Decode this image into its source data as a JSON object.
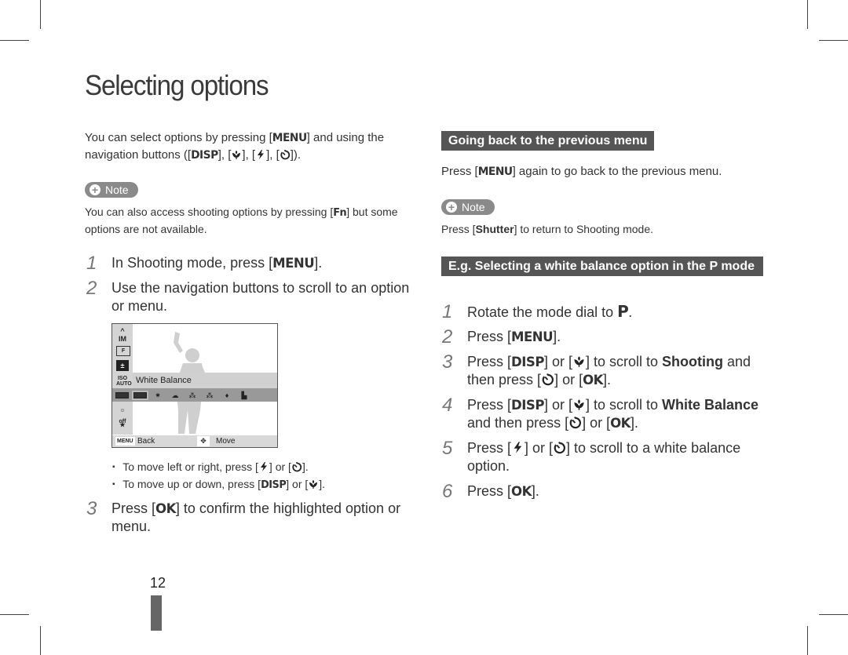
{
  "page": {
    "title": "Selecting options",
    "page_number": "12"
  },
  "left": {
    "intro": {
      "t1": "You can select options by pressing [",
      "k1": "MENU",
      "t2": "] and using the navigation buttons ([",
      "k2": "DISP",
      "t3": "], [",
      "t4": "], [",
      "t5": "], [",
      "t6": "])."
    },
    "note": {
      "label": "Note",
      "t1": "You can also access shooting options by pressing [",
      "k1": "Fn",
      "t2": "] but some options are not available."
    },
    "steps": [
      {
        "num": "1",
        "t1": "In Shooting mode, press [",
        "k1": "MENU",
        "t2": "]."
      },
      {
        "num": "2",
        "text": "Use the navigation buttons to scroll to an option or menu."
      },
      {
        "num": "3",
        "t1": "Press [",
        "k1": "OK",
        "t2": "] to confirm the highlighted option or menu."
      }
    ],
    "camera_screen": {
      "side_icons": [
        "scroll-up",
        "size-m",
        "quality-f",
        "ev",
        "iso-auto",
        "face-detect-off",
        "smart-face-off"
      ],
      "selected_item": "White Balance",
      "options": [
        "auto-wb",
        "custom-wb",
        "daylight",
        "cloudy",
        "fluorescent-h",
        "fluorescent-l",
        "tungsten",
        "custom-set"
      ],
      "back_key": "MENU",
      "back_label": "Back",
      "move_label": "Move"
    },
    "bullets": [
      {
        "t1": "To move left or right, press [",
        "t2": "] or [",
        "t3": "]."
      },
      {
        "t1": "To move up or down, press [",
        "k1": "DISP",
        "t2": "] or [",
        "t3": "]."
      }
    ]
  },
  "right": {
    "section1": {
      "heading": "Going back to the previous menu",
      "t1": "Press [",
      "k1": "MENU",
      "t2": "] again to go back to the previous menu.",
      "note_label": "Note",
      "note_t1": "Press [",
      "note_k1": "Shutter",
      "note_t2": "] to return to Shooting mode."
    },
    "section2": {
      "heading": "E.g. Selecting a white balance option in the P mode",
      "steps": [
        {
          "num": "1",
          "t1": "Rotate the mode dial to ",
          "k1": "P",
          "t2": "."
        },
        {
          "num": "2",
          "t1": "Press [",
          "k1": "MENU",
          "t2": "]."
        },
        {
          "num": "3",
          "t1": "Press [",
          "k1": "DISP",
          "t2": "] or [",
          "t3": "] to scroll to ",
          "b1": "Shooting",
          "t4": " and then press [",
          "t5": "] or [",
          "k2": "OK",
          "t6": "]."
        },
        {
          "num": "4",
          "t1": "Press [",
          "k1": "DISP",
          "t2": "] or [",
          "t3": "] to scroll to ",
          "b1": "White Balance",
          "t4": " and then press [",
          "t5": "] or [",
          "k2": "OK",
          "t6": "]."
        },
        {
          "num": "5",
          "t1": "Press [",
          "t2": "] or [",
          "t3": "] to scroll to a white balance option."
        },
        {
          "num": "6",
          "t1": "Press [",
          "k1": "OK",
          "t2": "]."
        }
      ]
    }
  }
}
